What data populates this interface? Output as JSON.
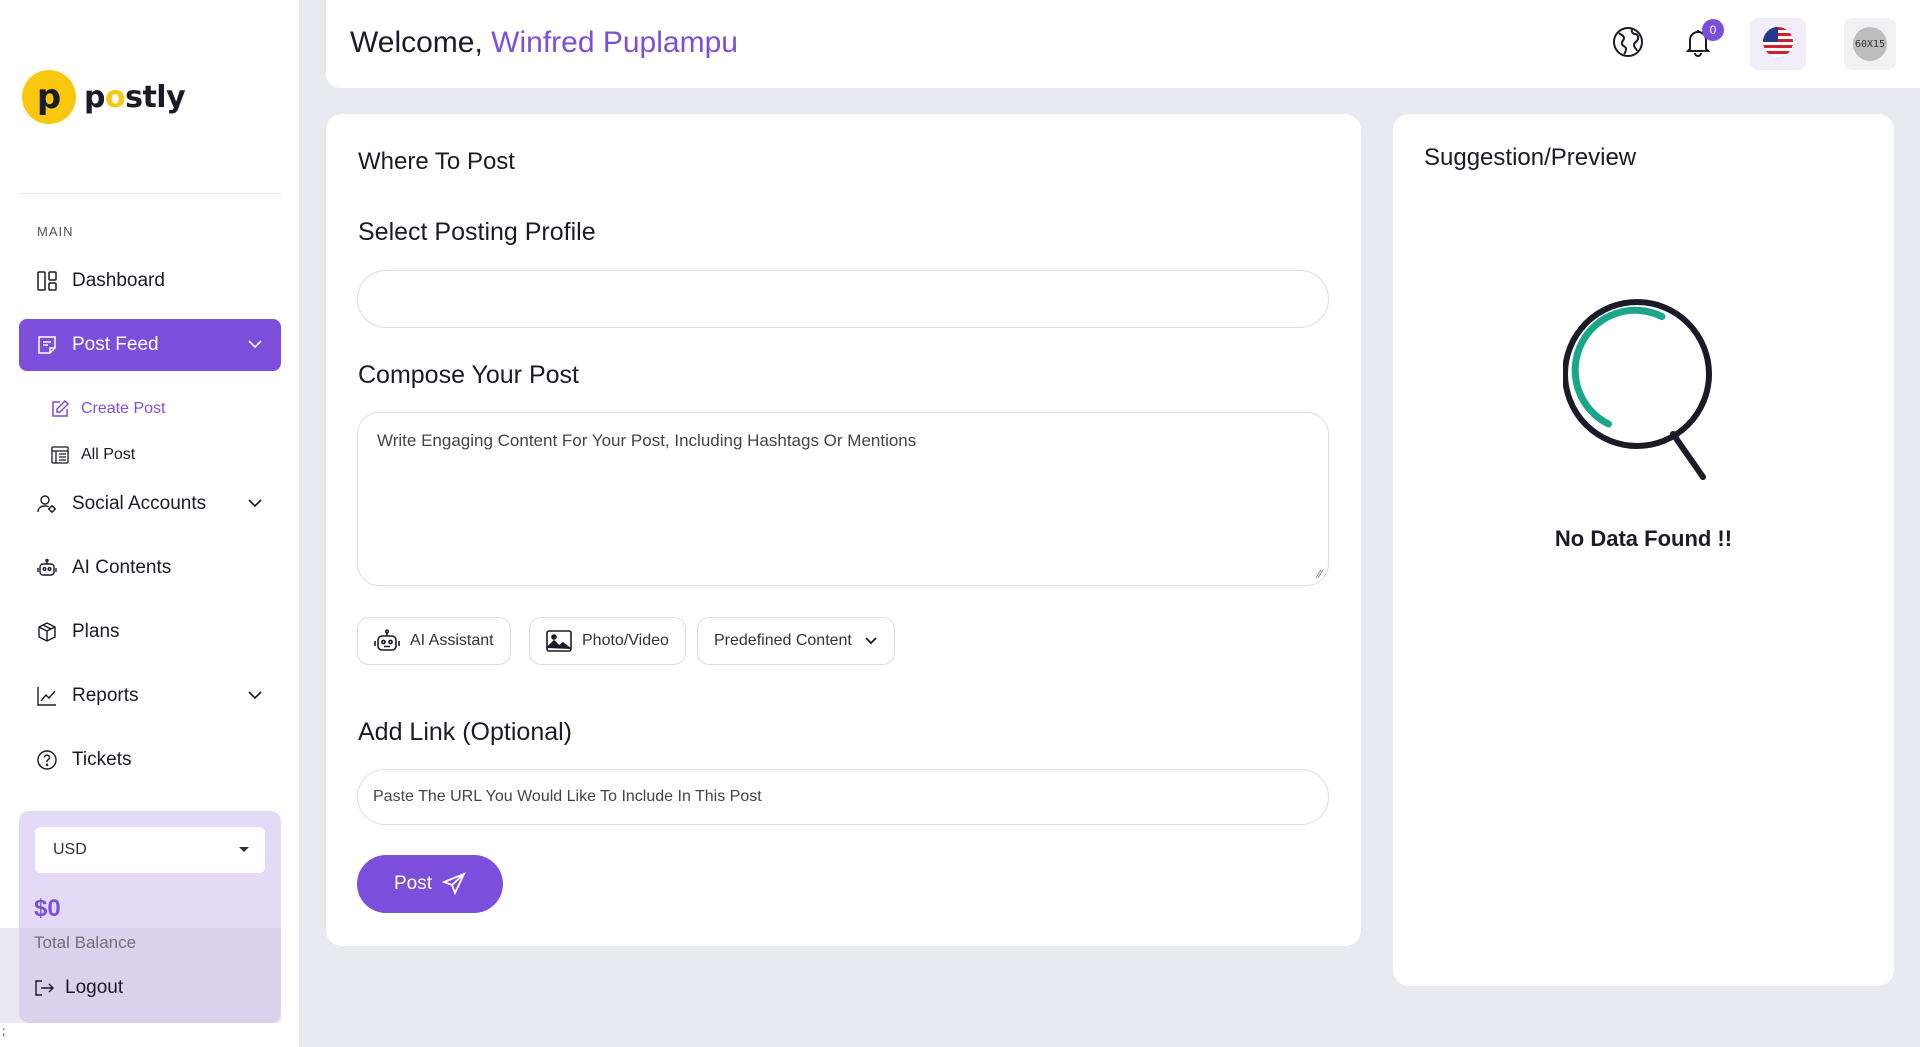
{
  "brand": {
    "logo_letter": "p",
    "name_pre": "p",
    "name_o": "o",
    "name_post": "stly"
  },
  "sidebar": {
    "section_label": "MAIN",
    "items": [
      {
        "label": "Dashboard",
        "icon": "dashboard-icon"
      },
      {
        "label": "Post Feed",
        "icon": "post-feed-icon",
        "active": true
      },
      {
        "label": "Social Accounts",
        "icon": "social-accounts-icon"
      },
      {
        "label": "AI Contents",
        "icon": "robot-icon"
      },
      {
        "label": "Plans",
        "icon": "box-icon"
      },
      {
        "label": "Reports",
        "icon": "chart-line-icon"
      },
      {
        "label": "Tickets",
        "icon": "question-circle-icon"
      }
    ],
    "sub_items": [
      {
        "label": "Create Post",
        "icon": "edit-icon",
        "active": true
      },
      {
        "label": "All Post",
        "icon": "list-icon"
      }
    ],
    "balance": {
      "currency": "USD",
      "amount": "$0",
      "label": "Total Balance"
    },
    "logout_label": "Logout"
  },
  "header": {
    "welcome_prefix": "Welcome,",
    "user_name": "Winfred Puplampu",
    "notification_count": "0",
    "avatar_text": "60X15"
  },
  "compose": {
    "title": "Where To Post",
    "profile_label": "Select Posting Profile",
    "compose_label": "Compose Your Post",
    "compose_placeholder": "Write Engaging Content For Your Post, Including Hashtags Or Mentions",
    "tools": {
      "ai_assistant": "AI Assistant",
      "photo_video": "Photo/Video",
      "predefined": "Predefined Content"
    },
    "link_label": "Add Link (Optional)",
    "link_placeholder": "Paste The URL You Would Like To Include In This Post",
    "post_button": "Post"
  },
  "preview": {
    "title": "Suggestion/Preview",
    "empty_text": "No Data Found !!"
  },
  "colors": {
    "accent": "#7b4fdc",
    "brand_yellow": "#f9c80e",
    "background": "#e9eaef",
    "spinner_green": "#1aa68a"
  },
  "corner_mark": ";"
}
